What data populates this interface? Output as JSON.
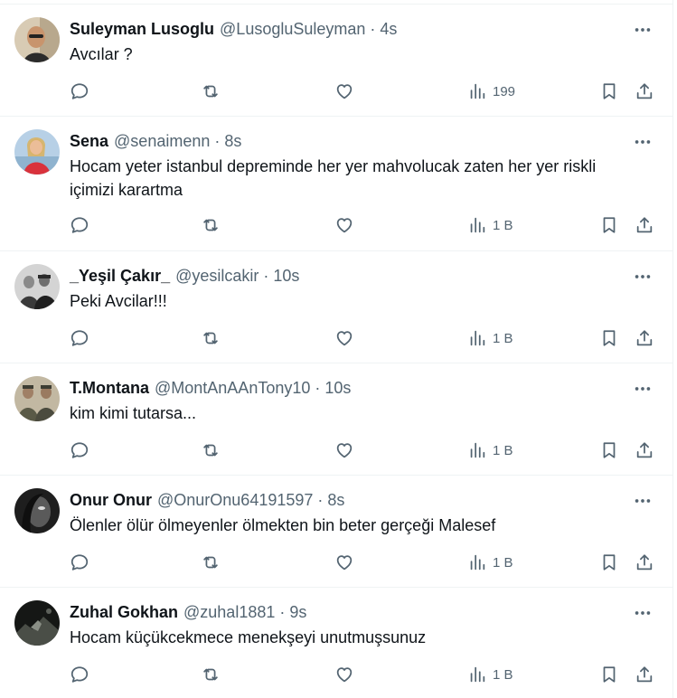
{
  "tweets": [
    {
      "name": "Suleyman Lusoglu",
      "handle": "@LusogluSuleyman",
      "time": "4s",
      "text": "Avcılar ?",
      "views": "199",
      "avatar_icon": "man-portrait-avatar",
      "avatar_colors": [
        "#c9b79c",
        "#2b2b2b"
      ]
    },
    {
      "name": "Sena",
      "handle": "@senaimenn",
      "time": "8s",
      "text": "Hocam yeter istanbul depreminde her yer mahvolucak zaten her yer riskli içimizi karartma",
      "views": "1 B",
      "avatar_icon": "woman-red-dress-avatar",
      "avatar_colors": [
        "#a9c7e0",
        "#d9323c"
      ]
    },
    {
      "name": "_Yeşil Çakır_",
      "handle": "@yesilcakir",
      "time": "10s",
      "text": "Peki Avcilar!!!",
      "views": "1 B",
      "avatar_icon": "group-photo-avatar",
      "avatar_colors": [
        "#cfcfcf",
        "#3a3a3a"
      ]
    },
    {
      "name": "T.Montana",
      "handle": "@MontAnAAnTony10",
      "time": "10s",
      "text": "kim kimi tutarsa...",
      "views": "1 B",
      "avatar_icon": "soldiers-avatar",
      "avatar_colors": [
        "#b9ae96",
        "#4b4b3e"
      ]
    },
    {
      "name": "Onur Onur",
      "handle": "@OnurOnu64191597",
      "time": "8s",
      "text": "Ölenler ölür ölmeyenler ölmekten bin beter gerçeği Malesef",
      "views": "1 B",
      "avatar_icon": "dark-face-avatar",
      "avatar_colors": [
        "#2a2a2a",
        "#6c6c6c"
      ]
    },
    {
      "name": "Zuhal Gokhan",
      "handle": "@zuhal1881",
      "time": "9s",
      "text": "Hocam küçükcekmece menekşeyi unutmuşsunuz",
      "views": "1 B",
      "avatar_icon": "dark-landscape-avatar",
      "avatar_colors": [
        "#1d1f1d",
        "#8a8f86"
      ]
    }
  ],
  "separator": "·",
  "icons": {
    "more": "more-horizontal-icon",
    "reply": "reply-bubble-icon",
    "retweet": "retweet-arrows-icon",
    "like": "heart-icon",
    "views": "bar-chart-icon",
    "bookmark": "bookmark-icon",
    "share": "share-upload-icon"
  },
  "colors": {
    "text": "#0f1419",
    "secondary": "#536471",
    "border": "#eff3f4"
  }
}
